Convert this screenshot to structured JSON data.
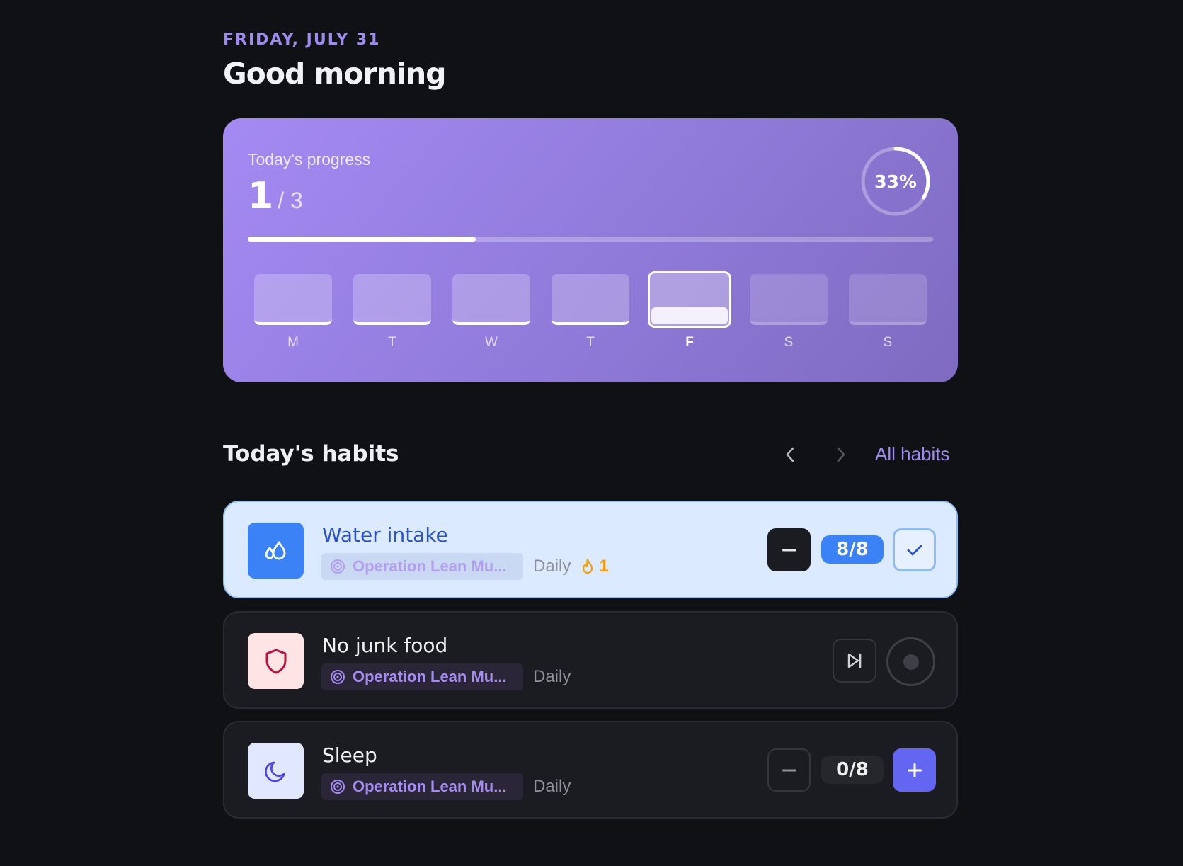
{
  "header": {
    "date": "FRIDAY, JULY 31",
    "greeting": "Good morning"
  },
  "progress": {
    "label": "Today's progress",
    "completed": "1",
    "total_text": "/ 3",
    "percent_text": "33%",
    "fraction": 0.333,
    "days": [
      {
        "letter": "M",
        "state": "past"
      },
      {
        "letter": "T",
        "state": "past"
      },
      {
        "letter": "W",
        "state": "past"
      },
      {
        "letter": "T",
        "state": "past"
      },
      {
        "letter": "F",
        "state": "today",
        "fill_fraction": 0.333
      },
      {
        "letter": "S",
        "state": "future"
      },
      {
        "letter": "S",
        "state": "future"
      }
    ]
  },
  "habits_section": {
    "title": "Today's habits",
    "all_link": "All habits",
    "prev_icon": "chevron-left-icon",
    "next_icon": "chevron-right-icon"
  },
  "habits": [
    {
      "name": "Water intake",
      "icon": "water-drops-icon",
      "goal": "Operation Lean Mu...",
      "frequency": "Daily",
      "streak": "1",
      "count": "8/8",
      "status": "done",
      "icon_bg": "#3b82f6"
    },
    {
      "name": "No junk food",
      "icon": "shield-icon",
      "goal": "Operation Lean Mu...",
      "frequency": "Daily",
      "status": "pending",
      "icon_bg": "#ffe4e6"
    },
    {
      "name": "Sleep",
      "icon": "moon-icon",
      "goal": "Operation Lean Mu...",
      "frequency": "Daily",
      "count": "0/8",
      "status": "pending",
      "icon_bg": "#e0e7ff"
    }
  ],
  "colors": {
    "accent": "#a08af4",
    "background": "#101115",
    "card_done": "#dceaff",
    "plus_button": "#6366f1",
    "streak": "#f59e0b"
  }
}
